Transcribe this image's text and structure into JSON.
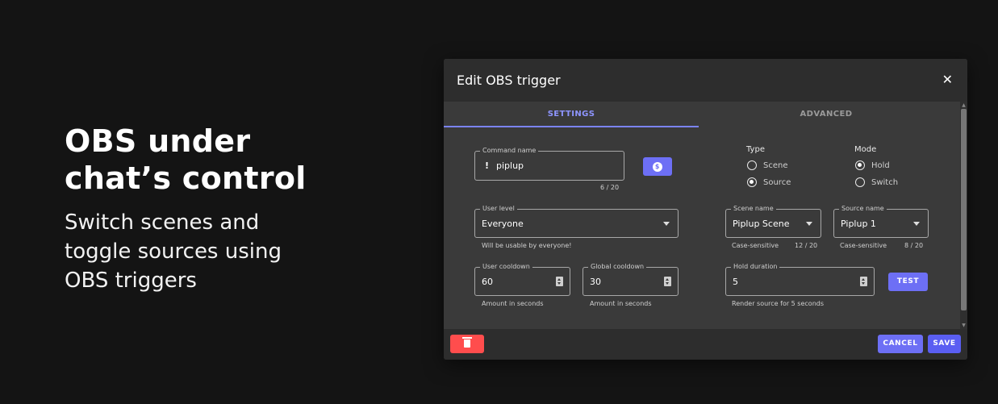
{
  "hero": {
    "title_line1": "OBS under",
    "title_line2": "chat’s control",
    "subtitle_line1": "Switch scenes and",
    "subtitle_line2": "toggle sources using",
    "subtitle_line3": "OBS triggers"
  },
  "dialog": {
    "title": "Edit OBS trigger",
    "close_glyph": "✕",
    "tabs": [
      {
        "label": "SETTINGS",
        "active": true
      },
      {
        "label": "ADVANCED",
        "active": false
      }
    ],
    "command": {
      "label": "Command name",
      "prefix": "!",
      "value": "piplup",
      "counter": "6 / 20",
      "cost_button_glyph": "$"
    },
    "type": {
      "title": "Type",
      "options": [
        {
          "label": "Scene",
          "selected": false
        },
        {
          "label": "Source",
          "selected": true
        }
      ]
    },
    "mode": {
      "title": "Mode",
      "options": [
        {
          "label": "Hold",
          "selected": true
        },
        {
          "label": "Switch",
          "selected": false
        }
      ]
    },
    "user_level": {
      "label": "User level",
      "value": "Everyone",
      "helper": "Will be usable by everyone!"
    },
    "scene_name": {
      "label": "Scene name",
      "value": "Piplup Scene",
      "helper": "Case-sensitive",
      "counter": "12 / 20"
    },
    "source_name": {
      "label": "Source name",
      "value": "Piplup 1",
      "helper": "Case-sensitive",
      "counter": "8 / 20"
    },
    "user_cooldown": {
      "label": "User cooldown",
      "value": "60",
      "helper": "Amount in seconds"
    },
    "global_cooldown": {
      "label": "Global cooldown",
      "value": "30",
      "helper": "Amount in seconds"
    },
    "hold_duration": {
      "label": "Hold duration",
      "value": "5",
      "helper": "Render source for 5 seconds"
    },
    "test_label": "TEST",
    "cancel_label": "CANCEL",
    "save_label": "SAVE"
  },
  "colors": {
    "accent": "#6d6ff5",
    "tab_active": "#8e95ff",
    "delete": "#ff4d4d",
    "background": "#141414"
  }
}
